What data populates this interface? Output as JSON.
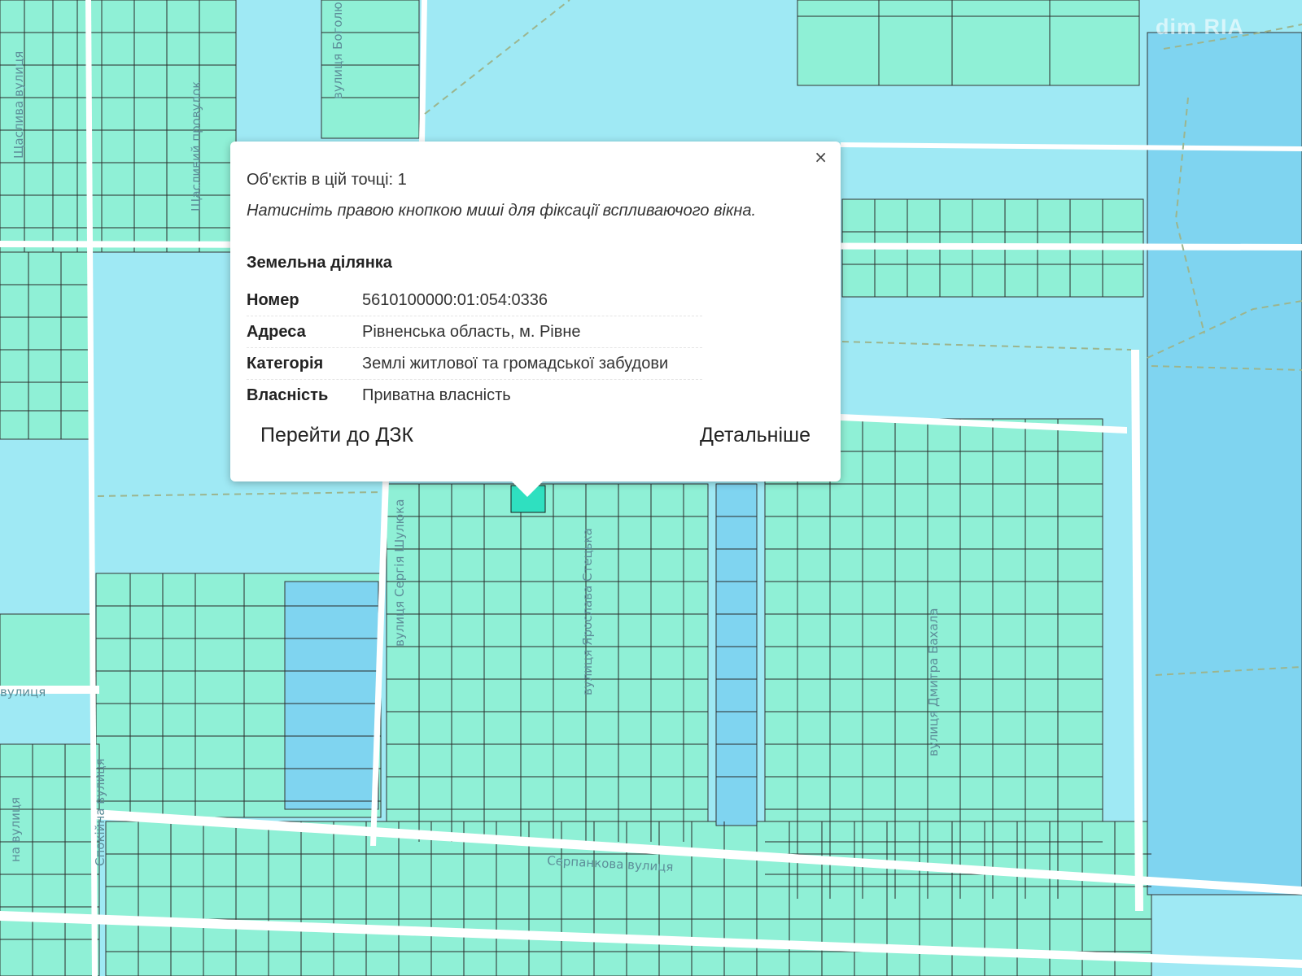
{
  "popup": {
    "count_text": "Об'єктів в цій точці: 1",
    "hint_text": "Натисніть правою кнопкою миші для фіксації вспливаючого вікна.",
    "close_symbol": "×",
    "section_title": "Земельна ділянка",
    "rows": [
      {
        "label": "Номер",
        "value": "5610100000:01:054:0336"
      },
      {
        "label": "Адреса",
        "value": "Рівненська область, м. Рівне"
      },
      {
        "label": "Категорія",
        "value": "Землі житлової та громадської забудови"
      },
      {
        "label": "Власність",
        "value": "Приватна власність"
      }
    ],
    "link_dzk": "Перейти до ДЗК",
    "link_details": "Детальніше"
  },
  "watermark": "dim RIA",
  "streets": {
    "bohol": "вулиця Боголю",
    "shchaslyva": "Щаслива вулиця",
    "shchaslyvyi_prov": "Щасливий провулок",
    "serhiia": "вулиця Сергія Шулюка",
    "yaroslava": "вулиця Ярослава Стецька",
    "dmytra": "вулиця Дмитра Бахала",
    "serpankova": "Серпанкова вулиця",
    "spokiina": "Спокійна вулиця",
    "left_a": "вулиця",
    "left_b": "на вулиця"
  },
  "colors": {
    "zone_background": "#9fe9f4",
    "parcel_fill": "#8ff0d6",
    "selected_parcel": "#2fe0c0",
    "road": "#ffffff",
    "boundary": "#222222",
    "dashed_path": "#9cb58e"
  }
}
